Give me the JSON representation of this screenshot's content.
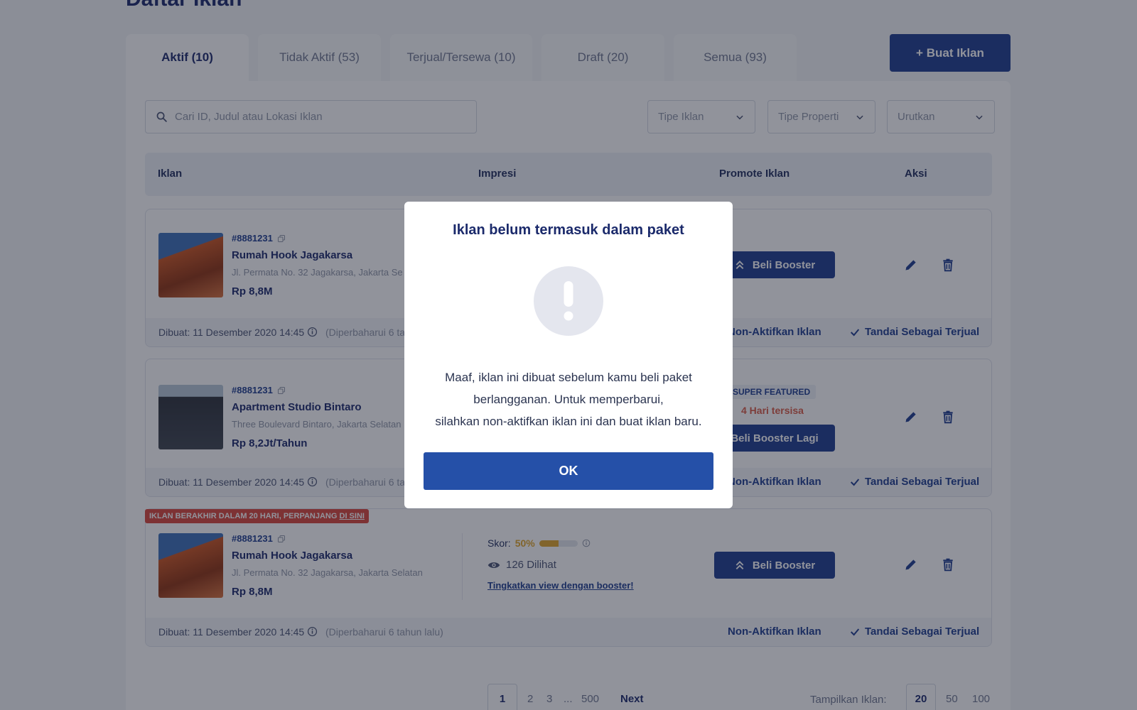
{
  "page": {
    "title": "Daftar Iklan"
  },
  "tabs": [
    {
      "label": "Aktif (10)"
    },
    {
      "label": "Tidak Aktif (53)"
    },
    {
      "label": "Terjual/Tersewa (10)"
    },
    {
      "label": "Draft (20)"
    },
    {
      "label": "Semua (93)"
    }
  ],
  "create_button": "+ Buat Iklan",
  "search": {
    "placeholder": "Cari ID, Judul atau Lokasi Iklan"
  },
  "filters": [
    "Tipe Iklan",
    "Tipe Properti",
    "Urutkan"
  ],
  "table": {
    "headers": [
      "Iklan",
      "Impresi",
      "Promote Iklan",
      "Aksi"
    ]
  },
  "listings": [
    {
      "id": "#8881231",
      "title": "Rumah Hook Jagakarsa",
      "address": "Jl. Permata No. 32 Jagakarsa, Jakarta Se",
      "price": "Rp 8,8M",
      "booster_label": "Beli Booster",
      "created": "Dibuat: 11 Desember 2020 14:45",
      "updated": "(Diperbaharui 6 ta",
      "deactivate": "Non-Aktifkan Iklan",
      "mark_sold": "Tandai Sebagai Terjual"
    },
    {
      "id": "#8881231",
      "title": "Apartment Studio Bintaro",
      "address": "Three Boulevard Bintaro, Jakarta Selatan",
      "price": "Rp 8,2Jt/Tahun",
      "badge": "SUPER FEATURED",
      "days_left": "4 Hari tersisa",
      "booster_label": "Beli Booster Lagi",
      "created": "Dibuat: 11 Desember 2020 14:45",
      "updated": "(Diperbaharui 6 ta",
      "deactivate": "Non-Aktifkan Iklan",
      "mark_sold": "Tandai Sebagai Terjual"
    },
    {
      "id": "#8881231",
      "title": "Rumah Hook Jagakarsa",
      "address": "Jl. Permata No. 32 Jagakarsa, Jakarta Selatan",
      "price": "Rp 8,8M",
      "expire_notice": "IKLAN BERAKHIR DALAM 20 HARI, PERPANJANG",
      "expire_link": "DI SINI",
      "score_label": "Skor:",
      "score_value": "50%",
      "score_fraction": 0.5,
      "views": "126 Dilihat",
      "boost_link": "Tingkatkan view dengan booster!",
      "booster_label": "Beli Booster",
      "created": "Dibuat: 11 Desember 2020 14:45",
      "updated": "(Diperbaharui 6 tahun lalu)",
      "deactivate": "Non-Aktifkan Iklan",
      "mark_sold": "Tandai Sebagai Terjual"
    }
  ],
  "pagination": {
    "pages": [
      "1",
      "2",
      "3",
      "...",
      "500"
    ],
    "next": "Next",
    "per_page_label": "Tampilkan Iklan:",
    "per_page_options": [
      "20",
      "50",
      "100"
    ]
  },
  "modal": {
    "title": "Iklan belum termasuk dalam paket",
    "message_lines": [
      "Maaf, iklan ini dibuat sebelum kamu beli paket",
      "berlangganan. Untuk memperbarui,",
      "silahkan non-aktifkan iklan ini dan buat iklan baru."
    ],
    "ok_label": "OK"
  },
  "colors": {
    "primary": "#1e3d8f",
    "ok_button": "#2550a8",
    "warning": "#d9453a",
    "score": "#e1a62a"
  }
}
